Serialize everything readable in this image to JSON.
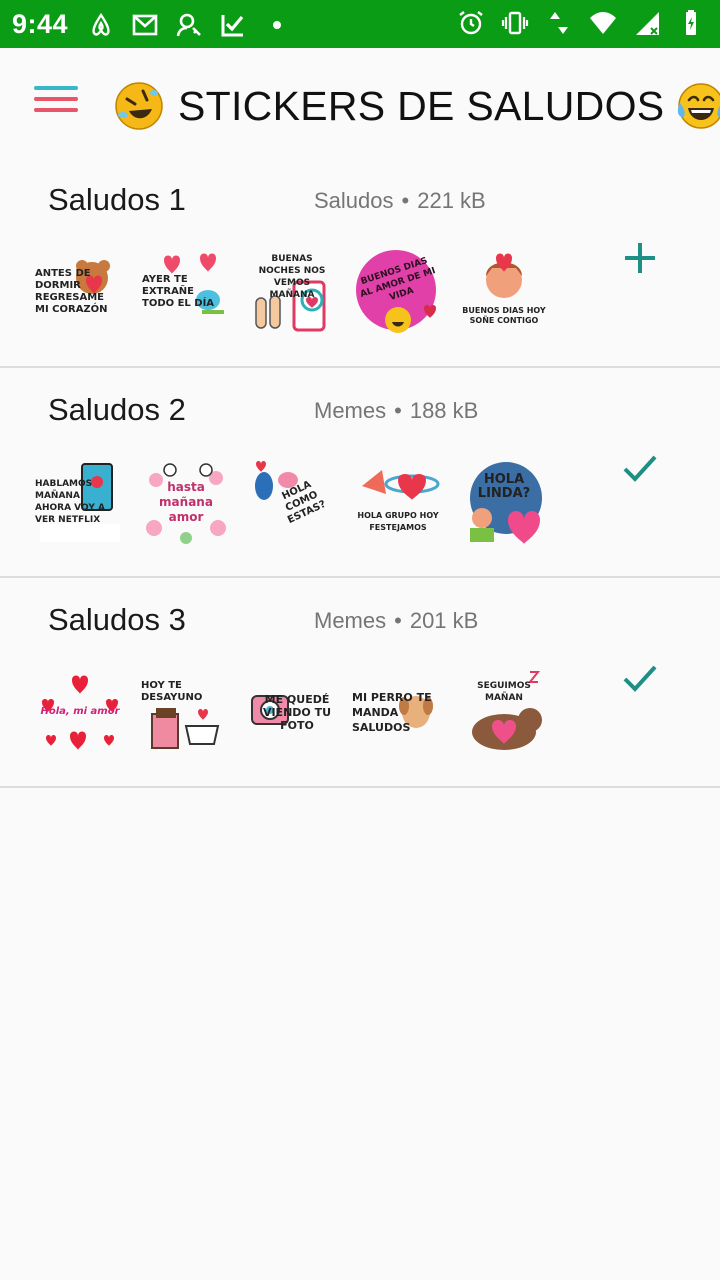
{
  "status_bar": {
    "time": "9:44",
    "left_icons": [
      "airbnb-icon",
      "gmail-icon",
      "key-person-icon",
      "check-flag-icon",
      "dot-icon"
    ],
    "right_icons": [
      "alarm-icon",
      "vibrate-icon",
      "data-arrows-icon",
      "wifi-icon",
      "signal-icon",
      "battery-icon"
    ]
  },
  "app_bar": {
    "title": "STICKERS DE SALUDOS",
    "left_emoji": "rolling-laughing-emoji",
    "right_emoji": "tears-of-joy-emoji"
  },
  "colors": {
    "status_bar": "#0b9c16",
    "accent": "#1e8f85",
    "menu_top": "#3ab7c7",
    "menu_rest": "#e8546a"
  },
  "packs": [
    {
      "name": "Saludos 1",
      "publisher": "Saludos",
      "separator": "•",
      "size": "221 kB",
      "action": "add",
      "stickers": [
        {
          "text": "ANTES DE DORMIR REGRESAME MI CORAZÓN"
        },
        {
          "text": "AYER TE EXTRAÑE TODO EL DÍA"
        },
        {
          "text": "BUENAS NOCHES NOS VEMOS MAÑANA"
        },
        {
          "text": "BUENOS DIAS AL AMOR DE MI VIDA"
        },
        {
          "text": "BUENOS DIAS HOY SOÑE CONTIGO"
        }
      ]
    },
    {
      "name": "Saludos 2",
      "publisher": "Memes",
      "separator": "•",
      "size": "188 kB",
      "action": "added",
      "stickers": [
        {
          "text": "HABLAMOS MAÑANA AHORA VOY A VER NETFLIX"
        },
        {
          "text": "hasta mañana amor"
        },
        {
          "text": "HOLA COMO ESTAS?"
        },
        {
          "text": "HOLA GRUPO HOY FESTEJAMOS"
        },
        {
          "text": "HOLA LINDA?"
        }
      ]
    },
    {
      "name": "Saludos 3",
      "publisher": "Memes",
      "separator": "•",
      "size": "201 kB",
      "action": "added",
      "stickers": [
        {
          "text": "Hola, mi amor"
        },
        {
          "text": "HOY TE DESAYUNO"
        },
        {
          "text": "ME QUEDÉ VIENDO TU FOTO"
        },
        {
          "text": "MI PERRO TE MANDA SALUDOS"
        },
        {
          "text": "SEGUIMOS MAÑAN"
        }
      ]
    }
  ]
}
